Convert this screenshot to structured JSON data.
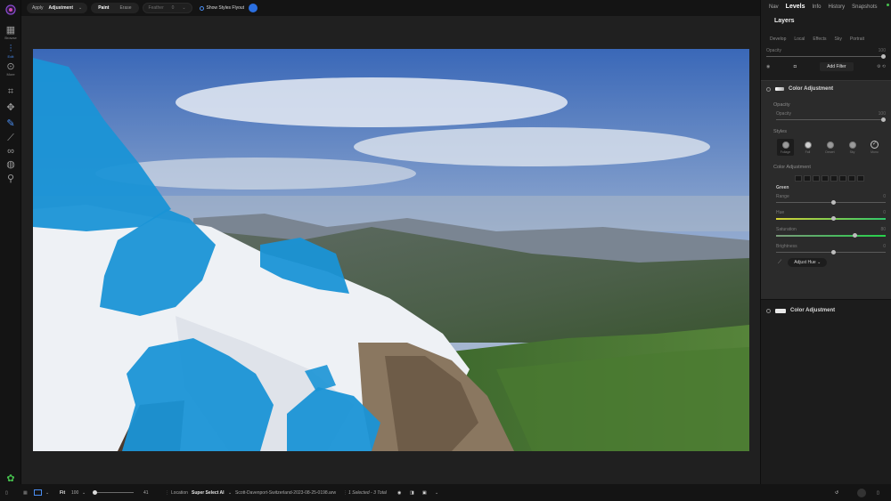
{
  "left_rail": {
    "items": [
      {
        "icon": "grid-icon",
        "label": "Browse"
      },
      {
        "icon": "sliders-icon",
        "label": "Edit"
      },
      {
        "icon": "dots-icon",
        "label": "More"
      }
    ]
  },
  "toolbar": {
    "apply_label": "Apply",
    "apply_value": "Adjustment",
    "paint_label": "Paint",
    "erase_label": "Erase",
    "feather_label": "Feather",
    "feather_value": "0",
    "flyout_label": "Show Styles Flyout"
  },
  "panel": {
    "tabs": [
      "Nav",
      "Levels",
      "Info",
      "History",
      "Snapshots"
    ],
    "active_tab": "Levels",
    "title": "Layers",
    "subtabs": [
      "Develop",
      "Local",
      "Effects",
      "Sky",
      "Portrait"
    ],
    "opacity_label": "Opacity",
    "opacity_value": "100",
    "add_filter_label": "Add Filter",
    "filter1": {
      "name": "Color Adjustment",
      "opacity_section": "Opacity",
      "opacity_label": "Opacity",
      "opacity_value": "100",
      "styles_section": "Styles",
      "styles": [
        "Foliage",
        "Fall",
        "Desert",
        "Sky",
        "Mono"
      ],
      "color_adj_section": "Color Adjustment",
      "color_name": "Green",
      "range_label": "Range",
      "range_value": "0",
      "hue_label": "Hue",
      "hue_value": "0",
      "saturation_label": "Saturation",
      "saturation_value": "80",
      "brightness_label": "Brightness",
      "brightness_value": "0",
      "adjust_hue_label": "Adjust Hue"
    },
    "filter2": {
      "name": "Color Adjustment"
    }
  },
  "bottom": {
    "fit_label": "Fit",
    "zoom_value": "100",
    "zoom_slider_value": "41",
    "location_label": "Location",
    "location_value": "Super Select AI",
    "filename": "Scott-Davenport-Switzerland-2023-08-25-0198.arw",
    "selection_status": "1 Selected - 3 Total"
  },
  "colors": {
    "accent": "#4a8df0",
    "mask_blue": "#1a93d6",
    "active_dot": "#46c24e"
  }
}
